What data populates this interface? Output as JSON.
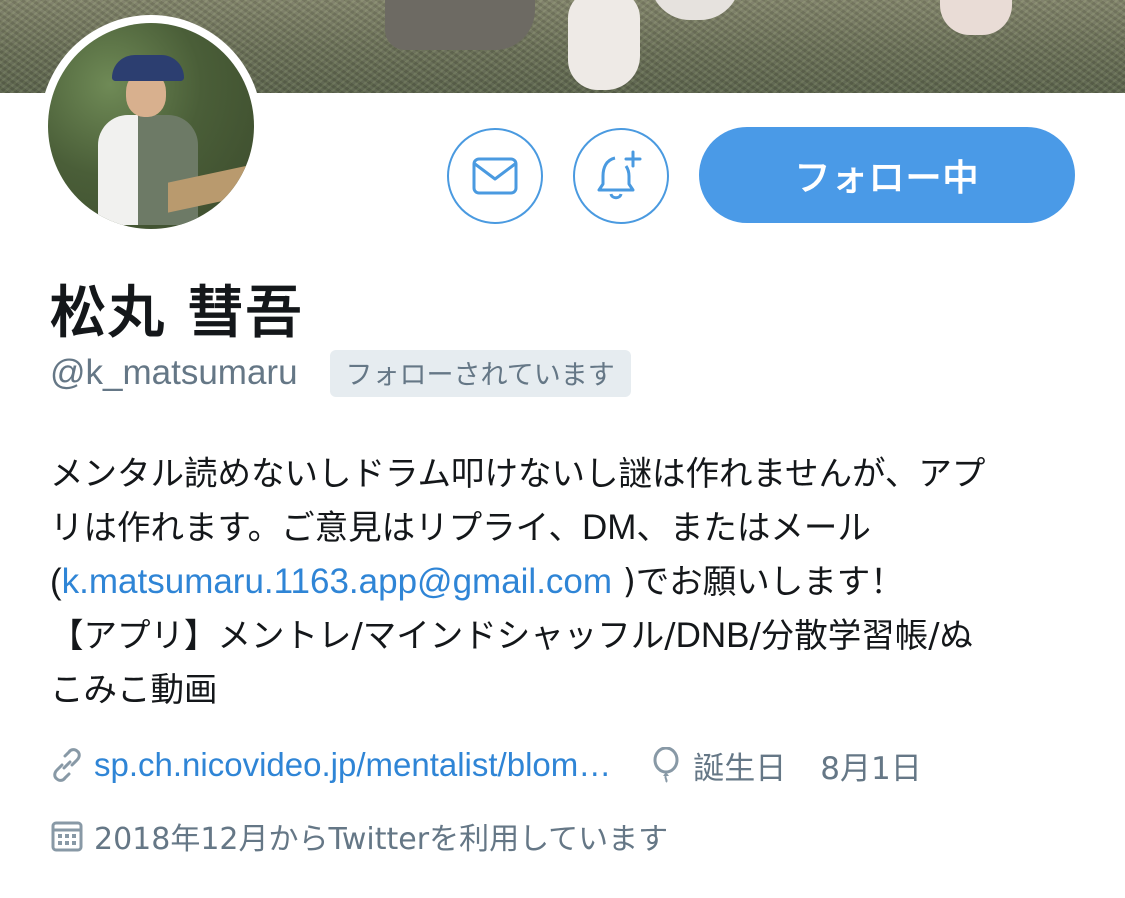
{
  "profile": {
    "display_name": "松丸 彗吾",
    "handle": "@k_matsumaru",
    "follows_you_badge": "フォローされています",
    "follow_button_label": "フォロー中",
    "bio": {
      "line1": "メンタル読めないしドラム叩けないし謎は作れませんが、アプ",
      "line2": "リは作れます。ご意見はリプライ、",
      "line2_dm": "DM",
      "line2_end": "、またはメール",
      "line3_open": "(",
      "email_link": "k.matsumaru.1163.app@gmail.com",
      "line3_end": " )でお願いします！",
      "line4_a": "【アプリ】メントレ/マインドシャッフル/",
      "line4_dnb": "DNB",
      "line4_b": "/分散学習帳/ぬ",
      "line5": "こみこ動画"
    },
    "url": "sp.ch.nicovideo.jp/mentalist/blom…",
    "birthday_label": "誕生日",
    "birthday_value": "8月1日",
    "joined": "2018年12月からTwitterを利用しています"
  },
  "icons": {
    "message": "mail-icon",
    "notifications": "bell-plus-icon",
    "url": "link-icon",
    "birthday": "balloon-icon",
    "joined": "calendar-icon"
  },
  "colors": {
    "accent": "#4a9ae7",
    "link": "#2f85d6",
    "secondary_text": "#657786",
    "badge_bg": "#e6ecf0"
  }
}
